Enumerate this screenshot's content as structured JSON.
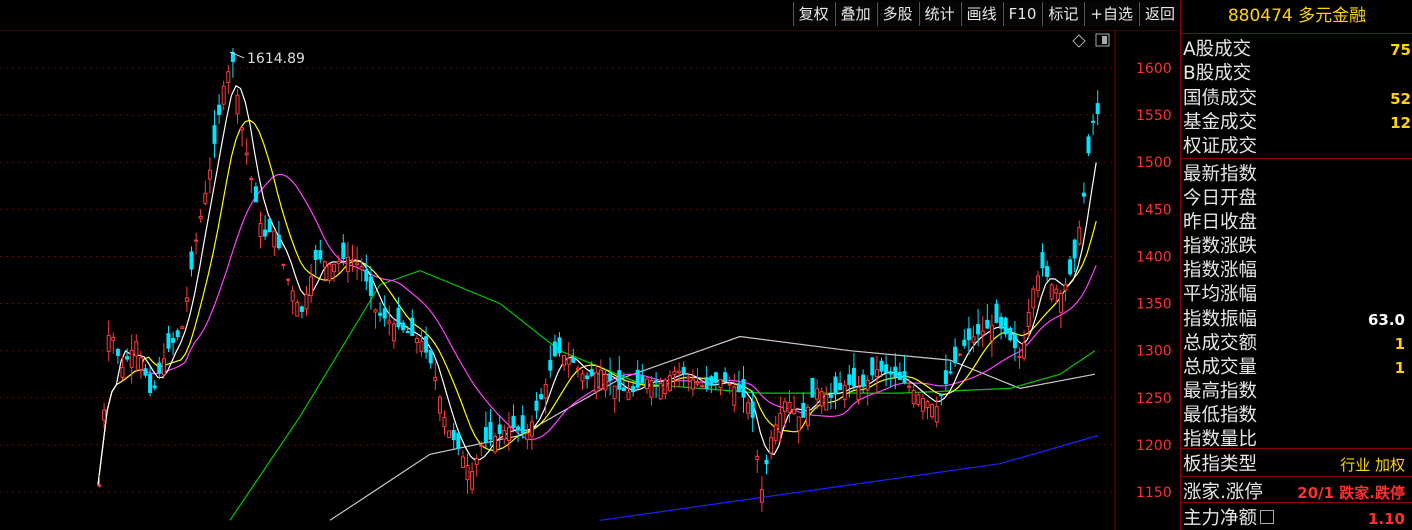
{
  "toolbar": {
    "buttons": [
      "复权",
      "叠加",
      "多股",
      "统计",
      "画线",
      "F10",
      "标记",
      "+自选",
      "返回"
    ]
  },
  "side": {
    "title": "880474 多元金融",
    "rows": [
      {
        "label": "A股成交",
        "value": "75",
        "color": "#ffd400"
      },
      {
        "label": "B股成交",
        "value": ""
      },
      {
        "label": "国债成交",
        "value": "52",
        "color": "#ffd400"
      },
      {
        "label": "基金成交",
        "value": "12",
        "color": "#ffd400"
      },
      {
        "label": "权证成交",
        "value": ""
      },
      {
        "label": "最新指数",
        "value": ""
      },
      {
        "label": "今日开盘",
        "value": ""
      },
      {
        "label": "昨日收盘",
        "value": ""
      },
      {
        "label": "指数涨跌",
        "value": ""
      },
      {
        "label": "指数涨幅",
        "value": ""
      },
      {
        "label": "平均涨幅",
        "value": ""
      },
      {
        "label": "指数振幅",
        "value": "63.0",
        "color": "#ffffff"
      },
      {
        "label": "总成交额",
        "value": "1",
        "color": "#ffd400"
      },
      {
        "label": "总成交量",
        "value": "1",
        "color": "#ffd400"
      },
      {
        "label": "最高指数",
        "value": ""
      },
      {
        "label": "最低指数",
        "value": ""
      },
      {
        "label": "指数量比",
        "value": ""
      },
      {
        "label": "板指类型",
        "value": "行业 加权",
        "color": "#ffd400"
      },
      {
        "label": "涨家.涨停",
        "value": "20/1 跌家.跌停",
        "color": "#ff3030"
      },
      {
        "label": "主力净额",
        "value": "1.10",
        "color": "#ff3030"
      }
    ]
  },
  "chart_data": {
    "type": "candlestick",
    "y_ticks": [
      1150,
      1200,
      1250,
      1300,
      1350,
      1400,
      1450,
      1500,
      1550,
      1600
    ],
    "ylim": [
      1120,
      1660
    ],
    "annotation": {
      "label": "1614.89",
      "value": 1614.89
    },
    "colors": {
      "up": "#ff3b3b",
      "down": "#00e5ff",
      "ma5": "#ffffff",
      "ma10": "#ffff00",
      "ma20": "#ff40ff",
      "ma30": "#00c800",
      "ma60": "#c8c8c8",
      "ma120": "#2020ff"
    }
  }
}
